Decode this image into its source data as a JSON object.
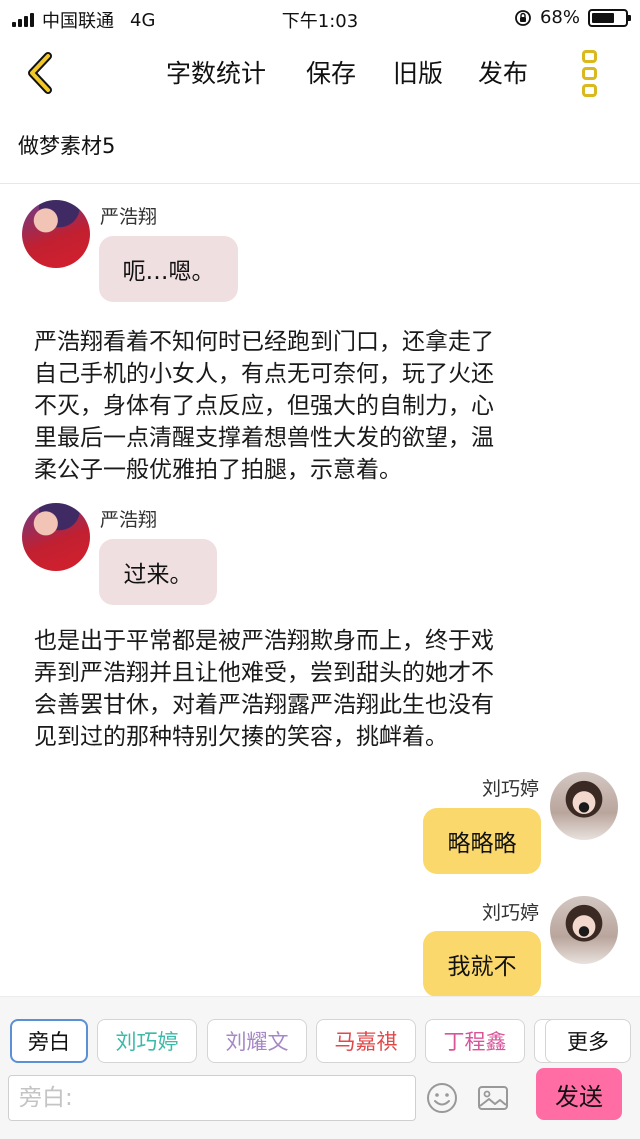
{
  "status_bar": {
    "carrier": "中国联通",
    "network": "4G",
    "time": "下午1:03",
    "battery_text": "68%",
    "battery_level": 0.68
  },
  "toolbar": {
    "back_icon": "chevron-left-icon",
    "word_count_label": "字数统计",
    "save_label": "保存",
    "old_version_label": "旧版",
    "publish_label": "发布",
    "more_icon": "more-vertical-icon",
    "accent_color": "#d9b91e"
  },
  "document": {
    "title": "做梦素材5"
  },
  "messages": [
    {
      "type": "character",
      "side": "left",
      "speaker": "严浩翔",
      "text": "呃…嗯。"
    },
    {
      "type": "narration",
      "lines": [
        "严浩翔看着不知何时已经跑到门口，还拿走了",
        "自己手机的小女人，有点无可奈何，玩了火还",
        "不灭，身体有了点反应，但强大的自制力，心",
        "里最后一点清醒支撑着想兽性大发的欲望，温",
        "柔公子一般优雅拍了拍腿，示意着。"
      ]
    },
    {
      "type": "character",
      "side": "left",
      "speaker": "严浩翔",
      "text": "过来。"
    },
    {
      "type": "narration",
      "lines": [
        "也是出于平常都是被严浩翔欺身而上，终于戏",
        "弄到严浩翔并且让他难受，尝到甜头的她才不",
        "会善罢甘休，对着严浩翔露严浩翔此生也没有",
        "见到过的那种特别欠揍的笑容，挑衅着。"
      ]
    },
    {
      "type": "character",
      "side": "right",
      "speaker": "刘巧婷",
      "text": "略略略"
    },
    {
      "type": "character",
      "side": "right",
      "speaker": "刘巧婷",
      "text": "我就不"
    }
  ],
  "colors": {
    "left_bubble": "#f0dfe1",
    "right_bubble": "#fbd86c",
    "send_button": "#ff6da4"
  },
  "roles": [
    {
      "label": "旁白",
      "active": true,
      "color": "#111111"
    },
    {
      "label": "刘巧婷",
      "active": false,
      "color": "#3cb9a8"
    },
    {
      "label": "刘耀文",
      "active": false,
      "color": "#a687c6"
    },
    {
      "label": "马嘉祺",
      "active": false,
      "color": "#e0484a"
    },
    {
      "label": "丁程鑫",
      "active": false,
      "color": "#d8559a"
    }
  ],
  "more_roles_label": "更多",
  "composer": {
    "placeholder": "旁白:",
    "emoji_icon": "emoji-icon",
    "image_icon": "image-icon",
    "send_label": "发送"
  }
}
